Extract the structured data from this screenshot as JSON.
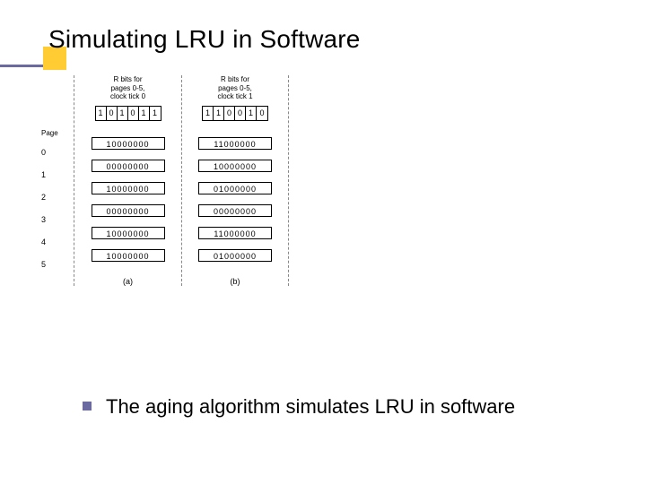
{
  "colors": {
    "accent": "#ffcc33",
    "underline": "#6a6aa0"
  },
  "title": "Simulating LRU in Software",
  "diagram": {
    "page_label": "Page",
    "pages": [
      "0",
      "1",
      "2",
      "3",
      "4",
      "5"
    ],
    "ticks": [
      {
        "header": "R bits for\npages 0-5,\nclock tick 0",
        "rbits": [
          "1",
          "0",
          "1",
          "0",
          "1",
          "1"
        ],
        "counters": [
          "10000000",
          "00000000",
          "10000000",
          "00000000",
          "10000000",
          "10000000"
        ],
        "sublabel": "(a)"
      },
      {
        "header": "R bits for\npages 0-5,\nclock tick 1",
        "rbits": [
          "1",
          "1",
          "0",
          "0",
          "1",
          "0"
        ],
        "counters": [
          "11000000",
          "10000000",
          "01000000",
          "00000000",
          "11000000",
          "01000000"
        ],
        "sublabel": "(b)"
      }
    ]
  },
  "bullets": [
    "The aging algorithm simulates LRU in software"
  ],
  "chart_data": {
    "type": "table",
    "title": "Aging algorithm — page counters across clock ticks",
    "pages": [
      0,
      1,
      2,
      3,
      4,
      5
    ],
    "ticks": [
      {
        "tick": 0,
        "r_bits": [
          1,
          0,
          1,
          0,
          1,
          1
        ],
        "counters": [
          "10000000",
          "00000000",
          "10000000",
          "00000000",
          "10000000",
          "10000000"
        ],
        "label": "(a)"
      },
      {
        "tick": 1,
        "r_bits": [
          1,
          1,
          0,
          0,
          1,
          0
        ],
        "counters": [
          "11000000",
          "10000000",
          "01000000",
          "00000000",
          "11000000",
          "01000000"
        ],
        "label": "(b)"
      }
    ]
  }
}
